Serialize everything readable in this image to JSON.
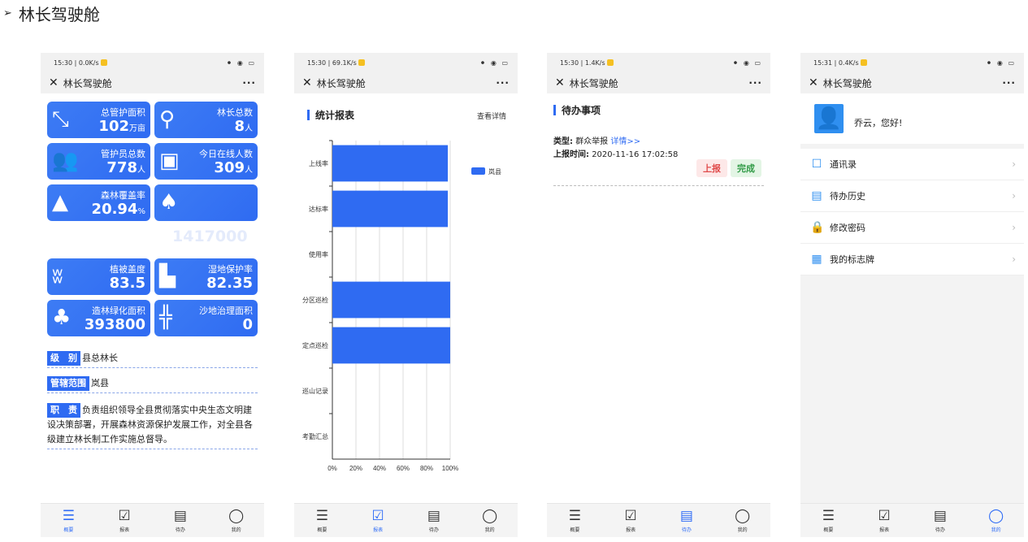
{
  "heading": {
    "bullet": "➢",
    "text": "林长驾驶舱"
  },
  "tabs": [
    "概要",
    "报表",
    "待办",
    "我的"
  ],
  "phones": [
    {
      "status_left": "15:30 | 0.0K/s",
      "title": "林长驾驶舱",
      "menu": "···"
    },
    {
      "status_left": "15:30 | 69.1K/s",
      "title": "林长驾驶舱",
      "menu": "···"
    },
    {
      "status_left": "15:30 | 1.4K/s",
      "title": "林长驾驶舱",
      "menu": "···"
    },
    {
      "status_left": "15:31 | 0.4K/s",
      "title": "林长驾驶舱",
      "menu": "···"
    }
  ],
  "status_right": "⚫ ◉ ▭",
  "overview": {
    "cards": [
      {
        "label": "总管护面积",
        "value": "102",
        "unit": "万亩",
        "icon": "area-icon"
      },
      {
        "label": "林长总数",
        "value": "8",
        "unit": "人",
        "icon": "map-pin-icon"
      },
      {
        "label": "管护员总数",
        "value": "778",
        "unit": "人",
        "icon": "users-icon"
      },
      {
        "label": "今日在线人数",
        "value": "309",
        "unit": "人",
        "icon": "monitor-user-icon"
      },
      {
        "label": "森林覆盖率",
        "value": "20.94",
        "unit": "%",
        "icon": "trees-icon"
      },
      {
        "label": "",
        "value": "",
        "unit": "",
        "icon": "forest-icon"
      },
      {
        "label": "植被盖度",
        "value": "83.5",
        "unit": "",
        "icon": "grass-icon"
      },
      {
        "label": "湿地保护率",
        "value": "82.35",
        "unit": "",
        "icon": "wetland-icon"
      },
      {
        "label": "造林绿化面积",
        "value": "393800",
        "unit": "",
        "icon": "afforest-icon"
      },
      {
        "label": "沙地治理面积",
        "value": "0",
        "unit": "",
        "icon": "cactus-icon"
      }
    ],
    "watermark_value": "1417000",
    "level": {
      "tag": "级　别",
      "value": "县总林长"
    },
    "scope": {
      "tag": "管辖范围",
      "value": "岚县"
    },
    "duty": {
      "tag": "职　责",
      "value": "负责组织领导全县贯彻落实中央生态文明建设决策部署，开展森林资源保护发展工作，对全县各级建立林长制工作实施总督导。"
    }
  },
  "report": {
    "title": "统计报表",
    "more": "查看详情",
    "chart_data": {
      "type": "bar",
      "orientation": "horizontal",
      "categories": [
        "上线率",
        "达标率",
        "使用率",
        "分区巡检",
        "定点巡检",
        "巡山记录",
        "考勤汇总"
      ],
      "series": [
        {
          "name": "岚县",
          "values": [
            98,
            98,
            0,
            100,
            100,
            0,
            0
          ]
        }
      ],
      "x_ticks": [
        "0%",
        "20%",
        "40%",
        "60%",
        "80%",
        "100%"
      ],
      "xlim": [
        0,
        100
      ],
      "legend": "top-right",
      "grid": true,
      "color": "#2f6bf2"
    }
  },
  "todo": {
    "title": "待办事项",
    "type_label": "类型:",
    "type_value": "群众举报",
    "detail_link": "详情>>",
    "time_label": "上报时间:",
    "time_value": "2020-11-16 17:02:58",
    "btn_report": "上报",
    "btn_done": "完成"
  },
  "mine": {
    "greeting": "乔云，您好!",
    "items": [
      {
        "label": "通讯录",
        "icon": "contacts-icon"
      },
      {
        "label": "待办历史",
        "icon": "todo-history-icon"
      },
      {
        "label": "修改密码",
        "icon": "lock-icon"
      },
      {
        "label": "我的标志牌",
        "icon": "signboard-icon"
      }
    ]
  },
  "colors": {
    "accent": "#2f6bf2",
    "report_btn_bg": "#fde8e8",
    "report_btn_fg": "#e04b4b",
    "done_btn_bg": "#e3f5e5",
    "done_btn_fg": "#2f9a45"
  }
}
